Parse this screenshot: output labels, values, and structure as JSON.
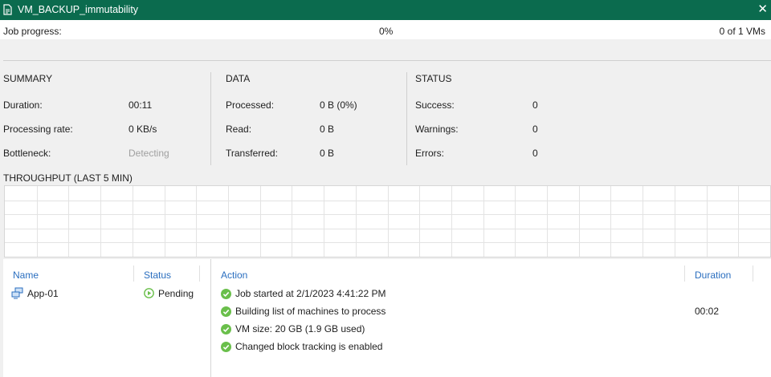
{
  "window": {
    "title": "VM_BACKUP_immutability",
    "close_glyph": "✕"
  },
  "progress": {
    "label": "Job progress:",
    "percent_text": "0%",
    "count_text": "0 of 1 VMs",
    "fraction": 0
  },
  "summary": {
    "heading": "SUMMARY",
    "rows": [
      {
        "label": "Duration:",
        "value": "00:11"
      },
      {
        "label": "Processing rate:",
        "value": "0 KB/s"
      },
      {
        "label": "Bottleneck:",
        "value": "Detecting"
      }
    ]
  },
  "data": {
    "heading": "DATA",
    "rows": [
      {
        "label": "Processed:",
        "value": "0 B (0%)"
      },
      {
        "label": "Read:",
        "value": "0 B"
      },
      {
        "label": "Transferred:",
        "value": "0 B"
      }
    ]
  },
  "status": {
    "heading": "STATUS",
    "rows": [
      {
        "label": "Success:",
        "value": "0"
      },
      {
        "label": "Warnings:",
        "value": "0"
      },
      {
        "label": "Errors:",
        "value": "0"
      }
    ]
  },
  "throughput": {
    "title": "THROUGHPUT (LAST 5 MIN)"
  },
  "vm_table": {
    "headers": {
      "name": "Name",
      "status": "Status"
    },
    "rows": [
      {
        "name": "App-01",
        "status": "Pending",
        "icon": "vm-icon",
        "status_icon": "play-icon"
      }
    ]
  },
  "action_table": {
    "headers": {
      "action": "Action",
      "duration": "Duration"
    },
    "rows": [
      {
        "text": "Job started at 2/1/2023 4:41:22 PM",
        "duration": "",
        "icon": "success-icon"
      },
      {
        "text": "Building list of machines to process",
        "duration": "00:02",
        "icon": "success-icon"
      },
      {
        "text": "VM size: 20 GB (1.9 GB used)",
        "duration": "",
        "icon": "success-icon"
      },
      {
        "text": "Changed block tracking is enabled",
        "duration": "",
        "icon": "success-icon"
      }
    ]
  },
  "colors": {
    "titlebar": "#0b6b4e",
    "accent_blue": "#2a6ebf",
    "success_green": "#6abf4b"
  }
}
